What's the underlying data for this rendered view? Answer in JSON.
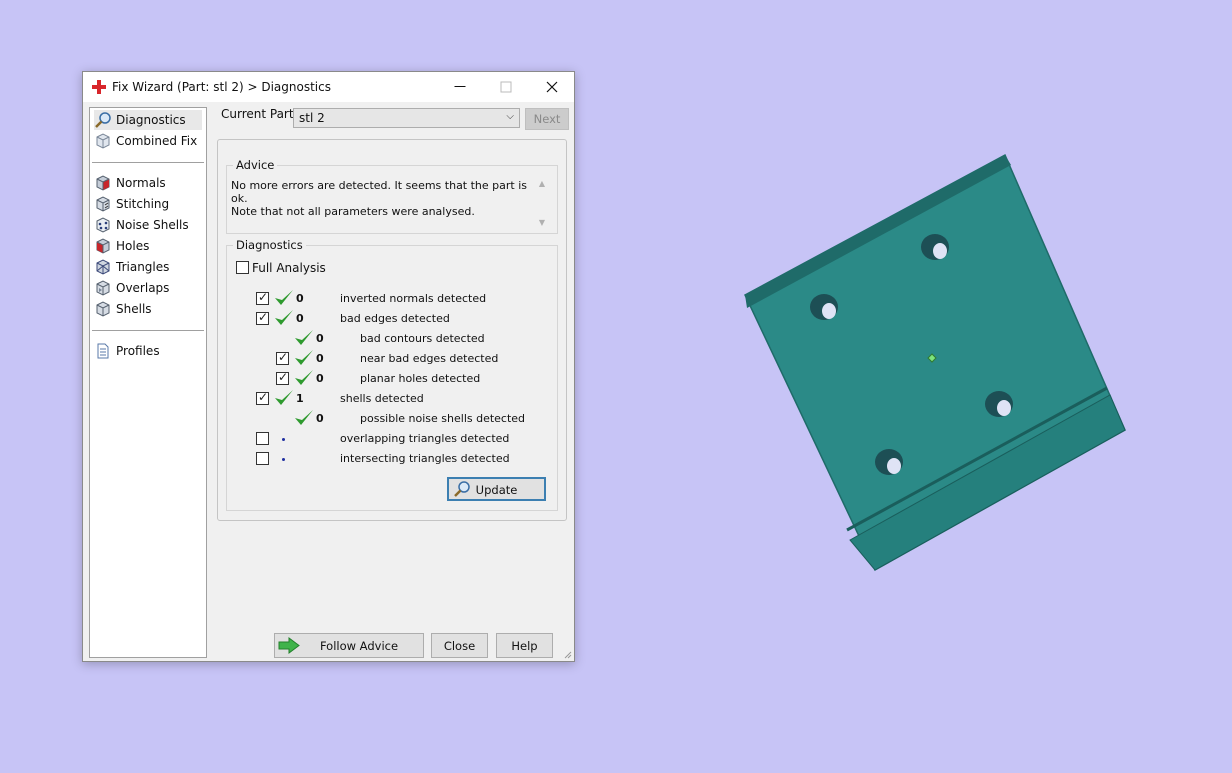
{
  "window": {
    "title": "Fix Wizard (Part: stl 2) > Diagnostics",
    "app_icon": "red-cross-icon",
    "controls": {
      "minimize": "—",
      "maximize": "☐",
      "close": "✕"
    }
  },
  "sidebar": {
    "items": [
      {
        "label": "Diagnostics",
        "icon": "magnifier-icon",
        "selected": true
      },
      {
        "label": "Combined Fix",
        "icon": "cube-icon"
      },
      {
        "label": "Normals",
        "icon": "normals-cube-icon"
      },
      {
        "label": "Stitching",
        "icon": "stitching-cube-icon"
      },
      {
        "label": "Noise Shells",
        "icon": "noise-shells-cube-icon"
      },
      {
        "label": "Holes",
        "icon": "holes-cube-icon"
      },
      {
        "label": "Triangles",
        "icon": "triangles-cube-icon"
      },
      {
        "label": "Overlaps",
        "icon": "overlaps-cube-icon"
      },
      {
        "label": "Shells",
        "icon": "shells-cube-icon"
      },
      {
        "label": "Profiles",
        "icon": "document-icon"
      }
    ]
  },
  "current_part": {
    "label": "Current Part:",
    "value": "stl 2",
    "next_label": "Next"
  },
  "advice": {
    "title": "Advice",
    "line1": "No more errors are detected. It seems that the part is ok.",
    "line2": "Note that not all parameters were analysed."
  },
  "diagnostics": {
    "title": "Diagnostics",
    "full_analysis_label": "Full Analysis",
    "full_analysis_checked": false,
    "rows": [
      {
        "checkbox": true,
        "checked": true,
        "status": "ok",
        "count": "0",
        "label": "inverted normals detected",
        "indent": 0
      },
      {
        "checkbox": true,
        "checked": true,
        "status": "ok",
        "count": "0",
        "label": "bad edges detected",
        "indent": 0
      },
      {
        "checkbox": false,
        "checked": false,
        "status": "ok",
        "count": "0",
        "label": "bad contours detected",
        "indent": 1
      },
      {
        "checkbox": true,
        "checked": true,
        "status": "ok",
        "count": "0",
        "label": "near bad edges detected",
        "indent": 1
      },
      {
        "checkbox": true,
        "checked": true,
        "status": "ok",
        "count": "0",
        "label": "planar holes detected",
        "indent": 1
      },
      {
        "checkbox": true,
        "checked": true,
        "status": "ok",
        "count": "1",
        "label": "shells detected",
        "indent": 0
      },
      {
        "checkbox": false,
        "checked": false,
        "status": "ok",
        "count": "0",
        "label": "possible noise shells detected",
        "indent": 1
      },
      {
        "checkbox": true,
        "checked": false,
        "status": "not-run",
        "count": "",
        "label": "overlapping triangles detected",
        "indent": 0
      },
      {
        "checkbox": true,
        "checked": false,
        "status": "not-run",
        "count": "",
        "label": "intersecting triangles detected",
        "indent": 0
      }
    ],
    "update_label": "Update"
  },
  "buttons": {
    "follow_advice": "Follow Advice",
    "close": "Close",
    "help": "Help"
  },
  "colors": {
    "background": "#c7c4f6",
    "part_face": "#2b8a87",
    "part_edge": "#1f6b69",
    "tick_green": "#2f9a2f",
    "update_border": "#3c7fb1"
  }
}
